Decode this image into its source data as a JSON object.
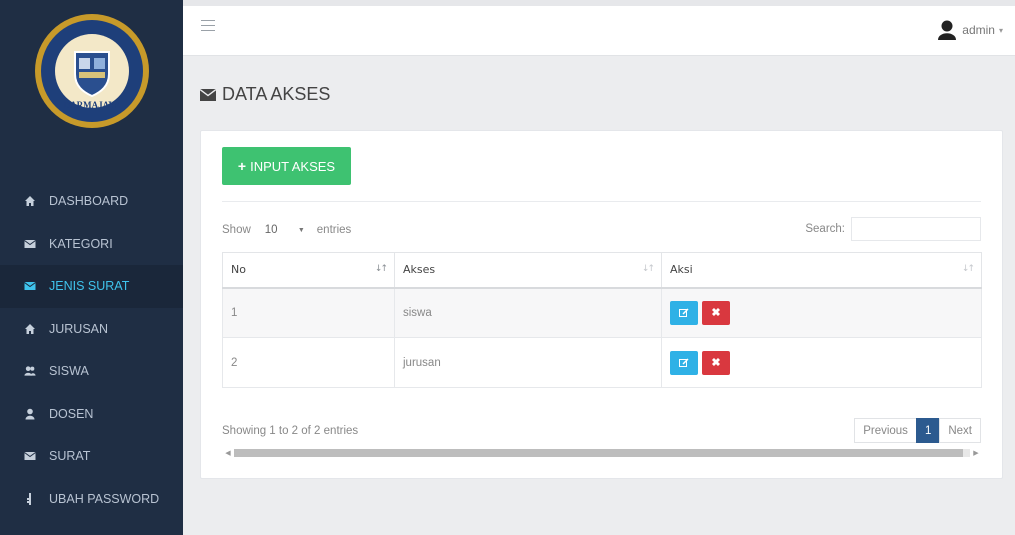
{
  "brand": {
    "logo_name": "darmajaya-logo",
    "logo_ring_text": "INSTITUT INFORMATIKA DAN BISNIS",
    "logo_bottom_text": "DARMAJAYA"
  },
  "sidebar": {
    "items": [
      {
        "label": "DASHBOARD",
        "icon": "home-icon",
        "active": false
      },
      {
        "label": "KATEGORI",
        "icon": "envelope-icon",
        "active": false
      },
      {
        "label": "JENIS SURAT",
        "icon": "envelope-icon",
        "active": true
      },
      {
        "label": "JURUSAN",
        "icon": "home-icon",
        "active": false
      },
      {
        "label": "SISWA",
        "icon": "users-icon",
        "active": false
      },
      {
        "label": "DOSEN",
        "icon": "user-icon",
        "active": false
      },
      {
        "label": "SURAT",
        "icon": "envelope-icon",
        "active": false
      },
      {
        "label": "UBAH PASSWORD",
        "icon": "key-icon",
        "active": false
      }
    ]
  },
  "topbar": {
    "user_label": "admin",
    "caret": "▾"
  },
  "page": {
    "title": "DATA AKSES"
  },
  "toolbar": {
    "add_label": "INPUT AKSES"
  },
  "table_controls": {
    "show_label": "Show",
    "length_value": "10",
    "entries_label": "entries",
    "search_label": "Search:"
  },
  "table": {
    "columns": [
      "No",
      "Akses",
      "Aksi"
    ],
    "rows": [
      {
        "no": "1",
        "akses": "siswa"
      },
      {
        "no": "2",
        "akses": "jurusan"
      }
    ]
  },
  "footer": {
    "info": "Showing 1 to 2 of 2 entries",
    "prev_label": "Previous",
    "page": "1",
    "next_label": "Next"
  },
  "colors": {
    "sidebar_bg": "#1f2e44",
    "active_item": "#3fc3ec",
    "add_button": "#3ec271",
    "edit_button": "#2fb1e6",
    "delete_button": "#d9383f",
    "active_page": "#2c5a8f"
  }
}
